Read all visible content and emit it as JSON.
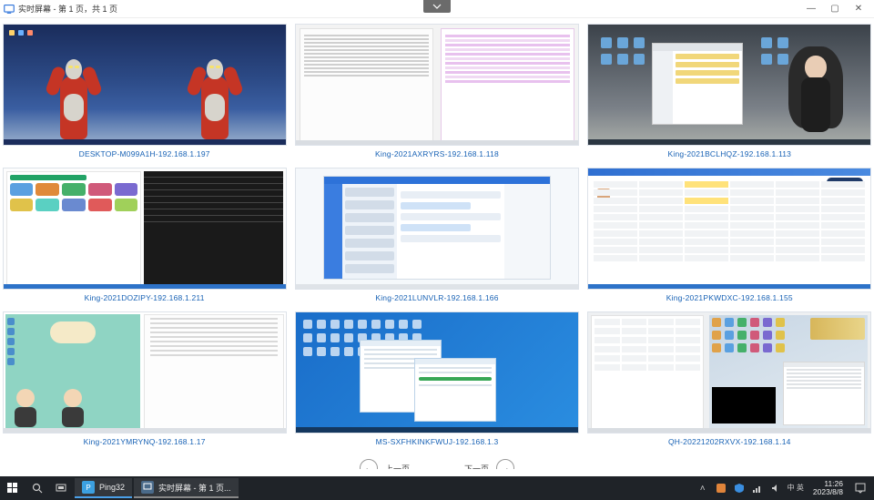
{
  "window": {
    "title": "实时屏幕 - 第 1 页，共 1 页",
    "controls": {
      "minimize": "—",
      "maximize": "▢",
      "close": "✕"
    }
  },
  "thumbnails": [
    {
      "label": "DESKTOP-M099A1H-192.168.1.197"
    },
    {
      "label": "King-2021AXRYRS-192.168.1.118"
    },
    {
      "label": "King-2021BCLHQZ-192.168.1.113"
    },
    {
      "label": "King-2021DOZIPY-192.168.1.211"
    },
    {
      "label": "King-2021LUNVLR-192.168.1.166"
    },
    {
      "label": "King-2021PKWDXC-192.168.1.155"
    },
    {
      "label": "King-2021YMRYNQ-192.168.1.17"
    },
    {
      "label": "MS-SXFHKINKFWUJ-192.168.1.3"
    },
    {
      "label": "QH-20221202RXVX-192.168.1.14"
    }
  ],
  "pagination": {
    "prev_label": "上一页",
    "next_label": "下一页",
    "prev_icon": "←",
    "next_icon": "→"
  },
  "taskbar": {
    "apps": [
      {
        "icon_letter": "P",
        "label": "Ping32"
      },
      {
        "icon_letter": "",
        "label": "实时屏幕 - 第 1 页..."
      }
    ],
    "ime": "中 英",
    "time": "11:26",
    "date": "2023/8/8"
  }
}
